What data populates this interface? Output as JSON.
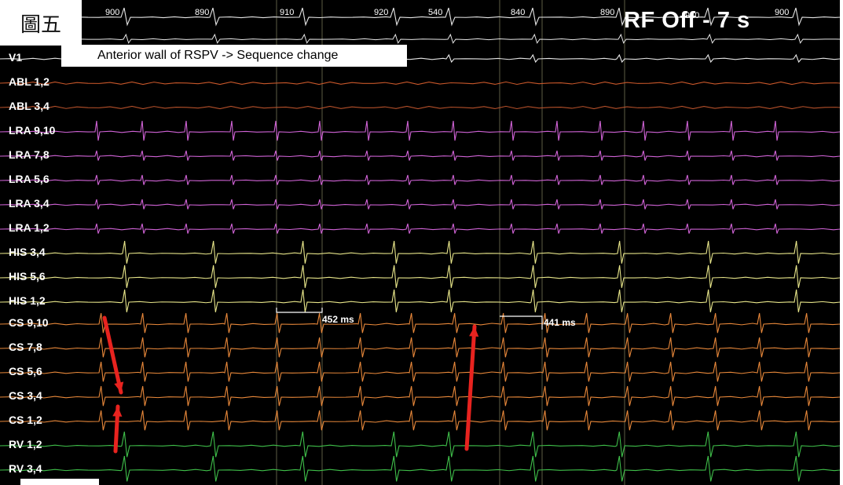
{
  "figure_label": "圖五",
  "title": "RF Off - 7 s",
  "annotation": "Anterior wall of RSPV -> Sequence change",
  "top_cycle_lengths": [
    "900",
    "890",
    "910",
    "920",
    "540",
    "840",
    "890",
    "940",
    "900"
  ],
  "channels": [
    {
      "label": "V1",
      "color": "#e6e6e6"
    },
    {
      "label": "ABL 1,2",
      "color": "#c8572a"
    },
    {
      "label": "ABL 3,4",
      "color": "#b5502a"
    },
    {
      "label": "LRA 9,10",
      "color": "#d063d6"
    },
    {
      "label": "LRA 7,8",
      "color": "#d063d6"
    },
    {
      "label": "LRA 5,6",
      "color": "#d063d6"
    },
    {
      "label": "LRA 3,4",
      "color": "#d063d6"
    },
    {
      "label": "LRA 1,2",
      "color": "#d063d6"
    },
    {
      "label": "HIS 3,4",
      "color": "#e8e68a"
    },
    {
      "label": "HIS 5,6",
      "color": "#e8e68a"
    },
    {
      "label": "HIS 1,2",
      "color": "#e8e68a"
    },
    {
      "label": "CS 9,10",
      "color": "#e8883a"
    },
    {
      "label": "CS 7,8",
      "color": "#e8883a"
    },
    {
      "label": "CS 5,6",
      "color": "#e8883a"
    },
    {
      "label": "CS 3,4",
      "color": "#e8883a"
    },
    {
      "label": "CS 1,2",
      "color": "#e8883a"
    },
    {
      "label": "RV 1,2",
      "color": "#3fbf4a"
    },
    {
      "label": "RV 3,4",
      "color": "#3fbf4a"
    }
  ],
  "measurements": [
    "452 ms",
    "441 ms"
  ],
  "colors": {
    "background": "#000000",
    "arrow": "#e8231f",
    "calipers": "#ffffff"
  }
}
